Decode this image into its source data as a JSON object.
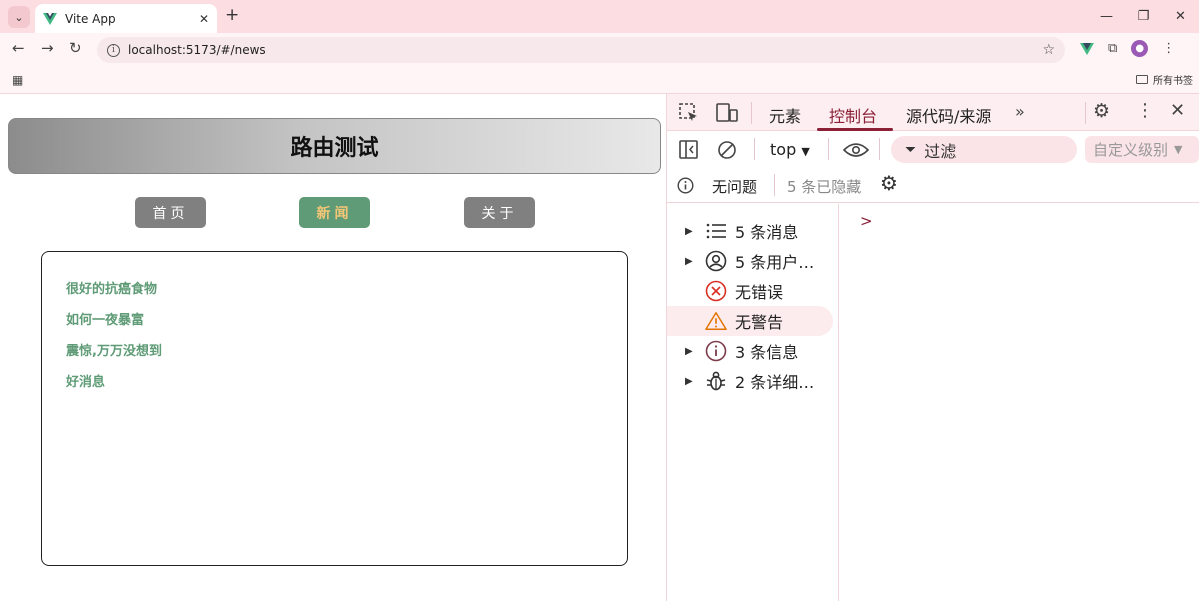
{
  "browser": {
    "tab_title": "Vite App",
    "url": "localhost:5173/#/news",
    "bookmarks_label": "所有书签",
    "tab_close": "✕",
    "new_tab": "+"
  },
  "page": {
    "title": "路由测试",
    "nav": [
      {
        "label": "首页",
        "active": false
      },
      {
        "label": "新闻",
        "active": true
      },
      {
        "label": "关于",
        "active": false
      }
    ],
    "news": [
      "很好的抗癌食物",
      "如何一夜暴富",
      "震惊,万万没想到",
      "好消息"
    ]
  },
  "devtools": {
    "tabs": [
      "元素",
      "控制台",
      "源代码/来源"
    ],
    "active_tab": "控制台",
    "context": "top",
    "filter_placeholder": "过滤",
    "levels": "自定义级别",
    "issues_none": "无问题",
    "hidden": "5 条已隐藏",
    "prompt": ">",
    "sidebar": [
      {
        "label": "5 条消息",
        "icon": "list-icon",
        "expandable": true
      },
      {
        "label": "5 条用户…",
        "icon": "user-icon",
        "expandable": true
      },
      {
        "label": "无错误",
        "icon": "error-icon",
        "expandable": false
      },
      {
        "label": "无警告",
        "icon": "warning-icon",
        "expandable": false,
        "highlighted": true
      },
      {
        "label": "3 条信息",
        "icon": "info-icon",
        "expandable": true
      },
      {
        "label": "2 条详细…",
        "icon": "bug-icon",
        "expandable": true
      }
    ]
  },
  "colors": {
    "accent": "#5e9b76",
    "active_nav_text": "#f4c776",
    "devtools_accent": "#8a1f36",
    "error": "#d93025",
    "warning": "#e37400"
  }
}
